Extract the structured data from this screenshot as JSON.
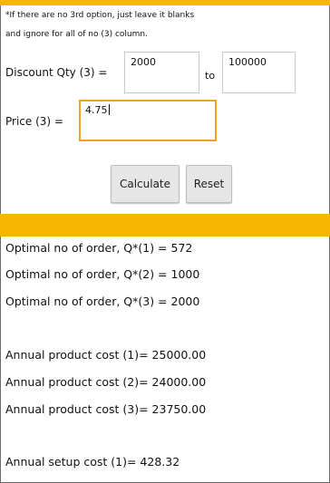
{
  "note": {
    "line1": "*If there are no 3rd option, just leave it blanks",
    "line2": "and ignore for all of no (3) column."
  },
  "discount": {
    "label": "Discount Qty (3) =",
    "from_value": "2000",
    "to_label": "to",
    "to_value": "100000"
  },
  "price": {
    "label": "Price (3) =",
    "value": "4.75"
  },
  "buttons": {
    "calculate": "Calculate",
    "reset": "Reset"
  },
  "results": {
    "optimal": [
      "Optimal no of order, Q*(1) = 572",
      "Optimal no of order, Q*(2) = 1000",
      "Optimal no of order, Q*(3) = 2000"
    ],
    "product_cost": [
      "Annual product cost (1)= 25000.00",
      "Annual product cost (2)= 24000.00",
      "Annual product cost (3)= 23750.00"
    ],
    "setup_cost": [
      "Annual setup cost (1)= 428.32"
    ]
  },
  "colors": {
    "accent": "#f5b700",
    "focus_border": "#f0a02a"
  }
}
